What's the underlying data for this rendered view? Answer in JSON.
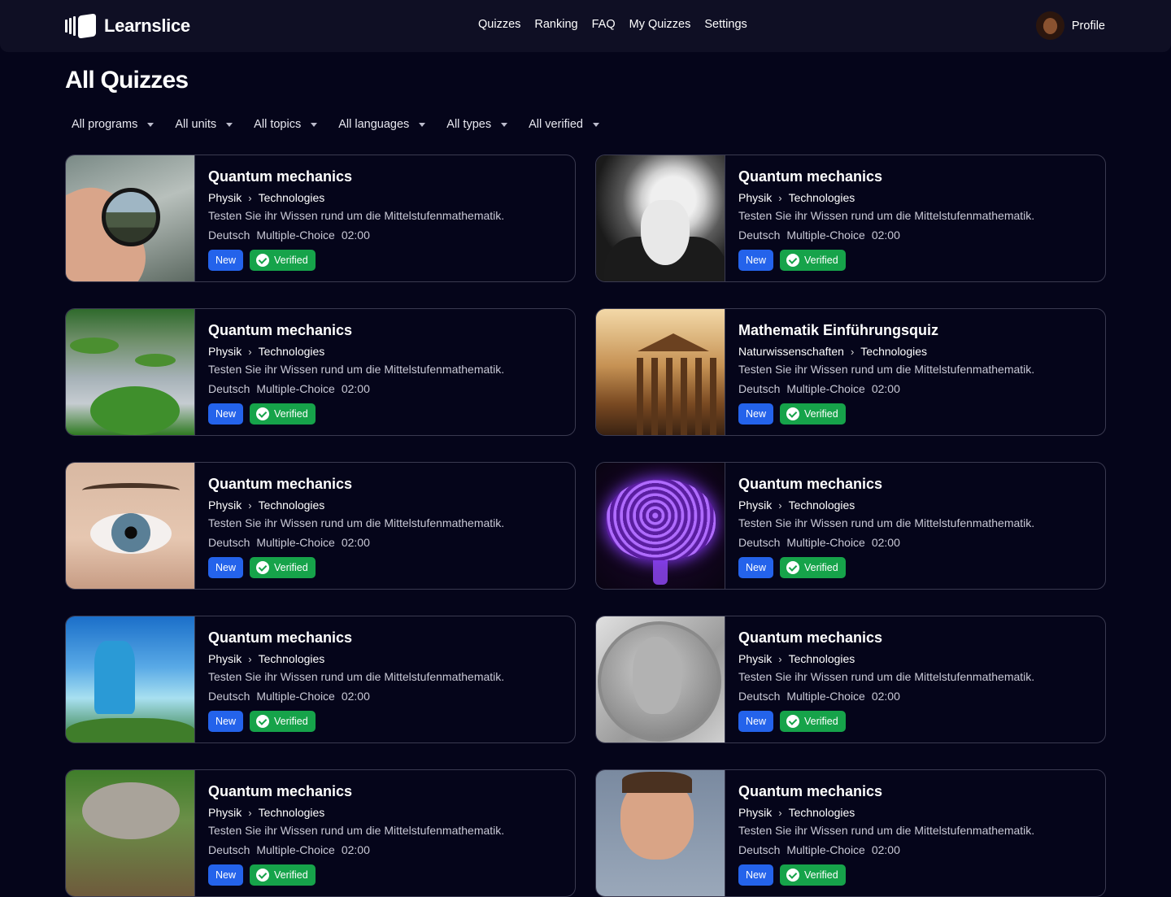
{
  "app": {
    "name": "Learnslice"
  },
  "nav": {
    "items": [
      "Quizzes",
      "Ranking",
      "FAQ",
      "My Quizzes",
      "Settings"
    ]
  },
  "profile": {
    "label": "Profile",
    "avatar_icon": "user-avatar"
  },
  "page": {
    "title": "All Quizzes"
  },
  "filters": [
    "All programs",
    "All units",
    "All topics",
    "All languages",
    "All types",
    "All verified"
  ],
  "badges": {
    "new": "New",
    "verified": "Verified"
  },
  "colors": {
    "background": "#05051a",
    "new_badge": "#2463eb",
    "verified_badge": "#16a34a",
    "card_border": "#3a3a50"
  },
  "quizzes": [
    {
      "image": "magnifying-lens",
      "title": "Quantum mechanics",
      "program": "Physik",
      "topic": "Technologies",
      "description": "Testen Sie ihr Wissen rund um die Mittelstufenmathematik.",
      "language": "Deutsch",
      "type": "Multiple-Choice",
      "duration": "02:00"
    },
    {
      "image": "bearded-man-portrait",
      "title": "Quantum mechanics",
      "program": "Physik",
      "topic": "Technologies",
      "description": "Testen Sie ihr Wissen rund um die Mittelstufenmathematik.",
      "language": "Deutsch",
      "type": "Multiple-Choice",
      "duration": "02:00"
    },
    {
      "image": "green-islands",
      "title": "Quantum mechanics",
      "program": "Physik",
      "topic": "Technologies",
      "description": "Testen Sie ihr Wissen rund um die Mittelstufenmathematik.",
      "language": "Deutsch",
      "type": "Multiple-Choice",
      "duration": "02:00"
    },
    {
      "image": "ancient-temple",
      "title": "Mathematik Einführungsquiz",
      "program": "Naturwissenschaften",
      "topic": "Technologies",
      "description": "Testen Sie ihr Wissen rund um die Mittelstufenmathematik.",
      "language": "Deutsch",
      "type": "Multiple-Choice",
      "duration": "02:00"
    },
    {
      "image": "eye-closeup",
      "title": "Quantum mechanics",
      "program": "Physik",
      "topic": "Technologies",
      "description": "Testen Sie ihr Wissen rund um die Mittelstufenmathematik.",
      "language": "Deutsch",
      "type": "Multiple-Choice",
      "duration": "02:00"
    },
    {
      "image": "glowing-brain",
      "title": "Quantum mechanics",
      "program": "Physik",
      "topic": "Technologies",
      "description": "Testen Sie ihr Wissen rund um die Mittelstufenmathematik.",
      "language": "Deutsch",
      "type": "Multiple-Choice",
      "duration": "02:00"
    },
    {
      "image": "fantasy-cliff",
      "title": "Quantum mechanics",
      "program": "Physik",
      "topic": "Technologies",
      "description": "Testen Sie ihr Wissen rund um die Mittelstufenmathematik.",
      "language": "Deutsch",
      "type": "Multiple-Choice",
      "duration": "02:00"
    },
    {
      "image": "nobel-medal",
      "title": "Quantum mechanics",
      "program": "Physik",
      "topic": "Technologies",
      "description": "Testen Sie ihr Wissen rund um die Mittelstufenmathematik.",
      "language": "Deutsch",
      "type": "Multiple-Choice",
      "duration": "02:00"
    },
    {
      "image": "hands-soil",
      "title": "Quantum mechanics",
      "program": "Physik",
      "topic": "Technologies",
      "description": "Testen Sie ihr Wissen rund um die Mittelstufenmathematik.",
      "language": "Deutsch",
      "type": "Multiple-Choice",
      "duration": "02:00"
    },
    {
      "image": "man-portrait",
      "title": "Quantum mechanics",
      "program": "Physik",
      "topic": "Technologies",
      "description": "Testen Sie ihr Wissen rund um die Mittelstufenmathematik.",
      "language": "Deutsch",
      "type": "Multiple-Choice",
      "duration": "02:00"
    }
  ]
}
